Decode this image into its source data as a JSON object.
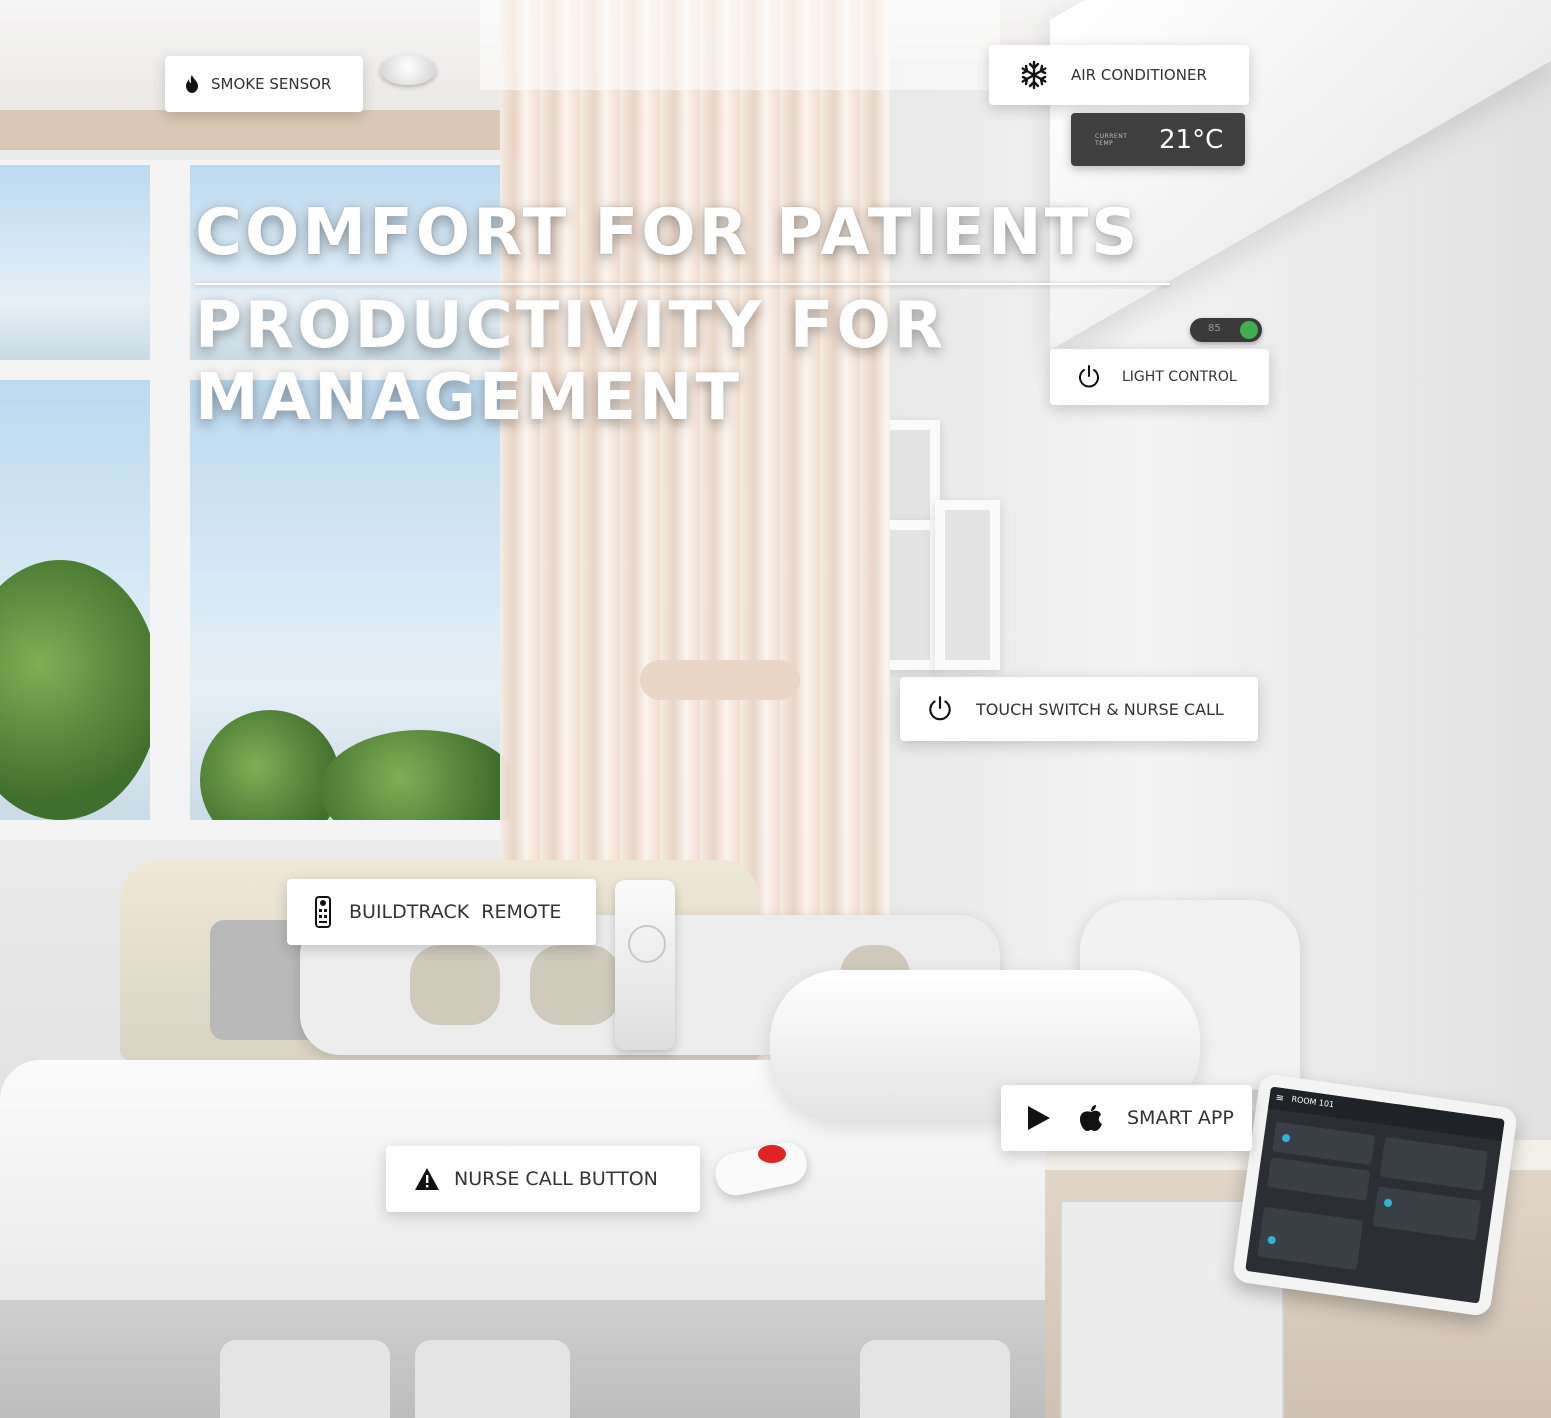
{
  "headline": {
    "line1": "COMFORT FOR PATIENTS",
    "line2": "PRODUCTIVITY FOR MANAGEMENT"
  },
  "labels": {
    "smoke_sensor": "SMOKE SENSOR",
    "air_conditioner": "AIR CONDITIONER",
    "light_control": "LIGHT CONTROL",
    "touch_switch": "TOUCH SWITCH & NURSE CALL",
    "remote": "BUILDTRACK  REMOTE",
    "smart_app": "SMART APP",
    "nurse_call_button": "NURSE CALL BUTTON"
  },
  "temperature": {
    "caption": "CURRENT TEMP",
    "value": "21°C"
  },
  "light_toggle": {
    "value": "85"
  },
  "tablet": {
    "title": "ROOM 101",
    "menu_glyph": "≡"
  },
  "icons": {
    "smoke_sensor": "flame-icon",
    "air_conditioner": "snowflake-icon",
    "light_control": "power-icon",
    "touch_switch": "power-icon",
    "remote": "remote-icon",
    "smart_app": [
      "play-store-icon",
      "apple-icon"
    ],
    "nurse_call_button": "warning-icon"
  },
  "colors": {
    "label_bg": "#ffffff",
    "label_text": "#333333",
    "temp_bg": "#3f3f3f",
    "nurse_button_red": "#e02424",
    "toggle_green": "#3fae4f"
  }
}
